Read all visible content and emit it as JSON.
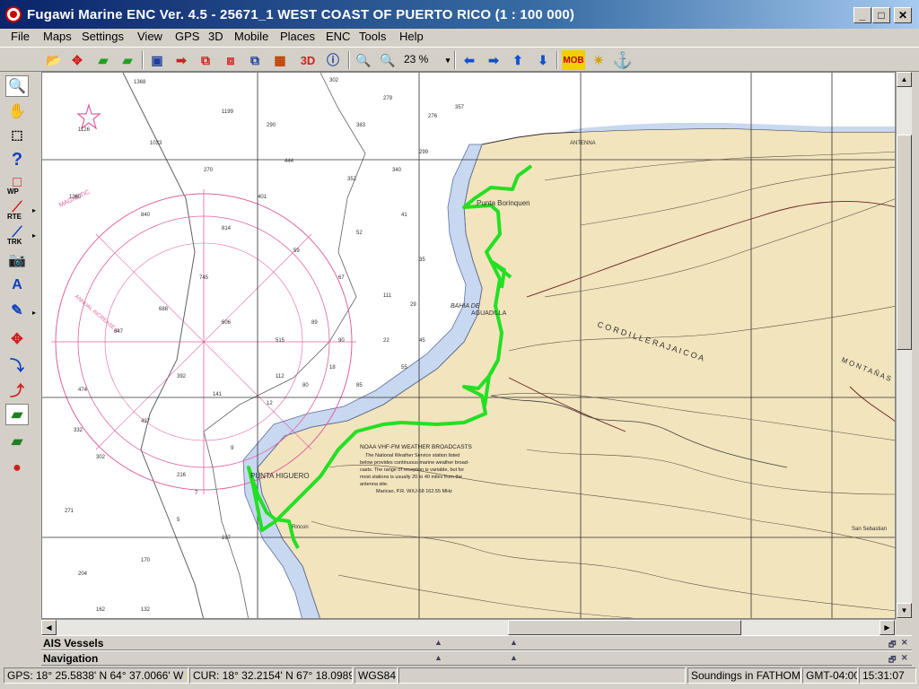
{
  "window": {
    "title": "Fugawi Marine ENC Ver. 4.5 - 25671_1  WEST COAST OF PUERTO RICO  (1 : 100 000)"
  },
  "menu": [
    "File",
    "Maps",
    "Settings",
    "View",
    "GPS",
    "3D",
    "Mobile",
    "Places",
    "ENC",
    "Tools",
    "Help"
  ],
  "toolbar": {
    "zoom_value": "23 %",
    "three_d_label": "3D",
    "mob_label": "MOB"
  },
  "lefttools": {
    "wp_label": "WP",
    "rte_label": "RTE",
    "trk_label": "TRK"
  },
  "map": {
    "place_labels": {
      "punta_borinquen": "Punta Borinquen",
      "aguadilla": "AGUADILLA",
      "cordillera_jaicoa": "C O R D I L L E R A   J A I C O A",
      "punta_higuero": "PUNTA HIGUERO",
      "montanas": "M O N T A Ñ A S",
      "bahia": "BAHIA DE",
      "antenna": "ANTENNA",
      "san_sebastian": "San Sebastian",
      "rincon": "Rincon",
      "noaa_title": "NOAA VHF-FM WEATHER BROADCASTS",
      "noaa_line1": "The National Weather Service station listed",
      "noaa_line2": "below provides continuous marine weather broad-",
      "noaa_line3": "casts. The range of reception is variable, but for",
      "noaa_line4": "most stations is usually 20 to 40 miles from the",
      "noaa_line5": "antenna site.",
      "noaa_station": "Maricao, P.R.        WXJ-68        162.55 MHz",
      "magnetic": "MAGNETIC",
      "annual": "ANNUAL INCREASE 6'"
    },
    "soundings": [
      "1368",
      "1199",
      "1126",
      "1033",
      "1360",
      "840",
      "814",
      "745",
      "688",
      "647",
      "606",
      "515",
      "474",
      "437",
      "392",
      "332",
      "302",
      "271",
      "204",
      "170",
      "141",
      "112",
      "89",
      "67",
      "59",
      "52",
      "41",
      "35",
      "29",
      "22",
      "18",
      "12",
      "9",
      "7",
      "5",
      "302",
      "279",
      "276",
      "299",
      "357",
      "401",
      "444",
      "352",
      "340",
      "383",
      "290",
      "270",
      "216",
      "197",
      "162",
      "132",
      "111",
      "90",
      "80",
      "85",
      "55",
      "45"
    ],
    "colors": {
      "land": "#f2e4bd",
      "shoal": "#c8d8f0",
      "track": "#22e022",
      "grid": "#303030",
      "contour": "#5a5040",
      "magenta": "#e060a0"
    }
  },
  "panels": {
    "ais_label": "AIS Vessels",
    "nav_label": "Navigation"
  },
  "status": {
    "gps": "GPS: 18° 25.5838' N 64° 37.0066' W",
    "cursor": "CUR: 18° 32.2154' N 67° 18.0989' W",
    "datum": "WGS84",
    "soundings": "Soundings in FATHOMS",
    "timezone": "GMT-04:00",
    "time": "15:31:07"
  }
}
